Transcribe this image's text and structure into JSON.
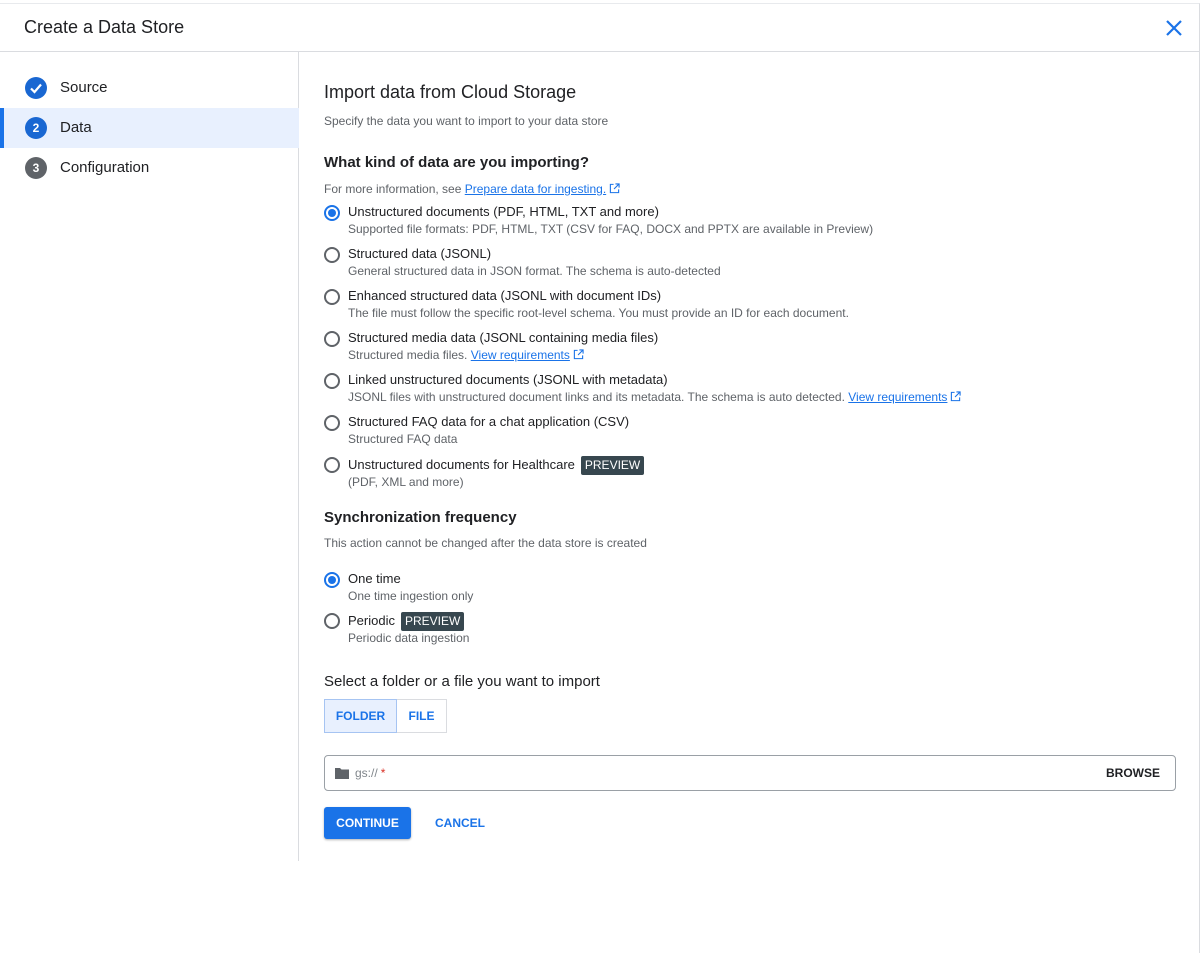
{
  "header": {
    "title": "Create a Data Store"
  },
  "steps": [
    {
      "num": "",
      "label": "Source"
    },
    {
      "num": "2",
      "label": "Data"
    },
    {
      "num": "3",
      "label": "Configuration"
    }
  ],
  "main": {
    "title": "Import data from Cloud Storage",
    "subtitle": "Specify the data you want to import to your data store",
    "kind_heading": "What kind of data are you importing?",
    "kind_info_prefix": "For more information, see",
    "kind_info_link": "Prepare data for ingesting.",
    "data_options": [
      {
        "label": "Unstructured documents (PDF, HTML, TXT and more)",
        "desc": "Supported file formats: PDF, HTML, TXT (CSV for FAQ, DOCX and PPTX are available in Preview)"
      },
      {
        "label": "Structured data (JSONL)",
        "desc": "General structured data in JSON format. The schema is auto-detected"
      },
      {
        "label": "Enhanced structured data (JSONL with document IDs)",
        "desc": "The file must follow the specific root-level schema. You must provide an ID for each document."
      },
      {
        "label": "Structured media data (JSONL containing media files)",
        "desc": "Structured media files.",
        "link": "View requirements"
      },
      {
        "label": "Linked unstructured documents (JSONL with metadata)",
        "desc": "JSONL files with unstructured document links and its metadata. The schema is auto detected.",
        "link": "View requirements"
      },
      {
        "label": "Structured FAQ data for a chat application (CSV)",
        "desc": "Structured FAQ data"
      },
      {
        "label": "Unstructured documents for Healthcare",
        "tag": "PREVIEW",
        "desc": "(PDF, XML and more)"
      }
    ],
    "sync_heading": "Synchronization frequency",
    "sync_subtitle": "This action cannot be changed after the data store is created",
    "sync_options": [
      {
        "label": "One time",
        "desc": "One time ingestion only"
      },
      {
        "label": "Periodic",
        "tag": "PREVIEW",
        "desc": "Periodic data ingestion"
      }
    ],
    "select_heading": "Select a folder or a file you want to import",
    "toggle": {
      "folder": "FOLDER",
      "file": "FILE"
    },
    "path": {
      "placeholder": "gs://",
      "required_mark": "*",
      "browse": "BROWSE"
    },
    "continue_label": "CONTINUE",
    "cancel_label": "CANCEL"
  },
  "selected": {
    "data_option": 0,
    "sync_option": 0,
    "toggle": "folder"
  },
  "colors": {
    "accent": "#1a73e8",
    "preview_tag": "#37474f",
    "active_step_bg": "#e8f0fe"
  }
}
